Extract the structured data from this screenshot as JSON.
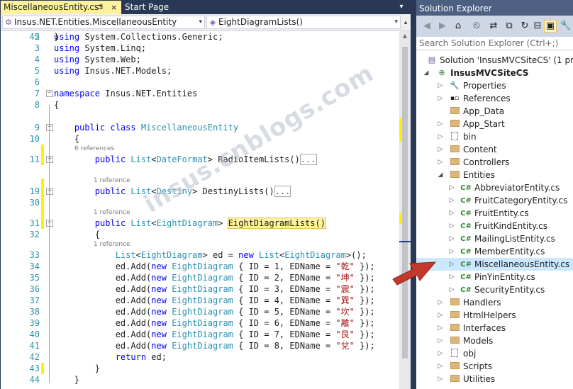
{
  "tabs": {
    "active": {
      "label": "MiscellaneousEntity.cs*",
      "pin": "⊐",
      "close": "×"
    },
    "start_page": {
      "label": "Start Page"
    },
    "dropdown": "▾"
  },
  "navigation": {
    "class_box": "Insus.NET.Entities.MiscellaneousEntity",
    "member_box": "EightDiagramLists()",
    "dropdown_glyph": "▾",
    "split_glyph": "▴"
  },
  "editor": {
    "watermark": "insus.cnblogs.com",
    "lines": [
      {
        "n": "2",
        "code": [
          {
            "c": "k",
            "t": "using"
          },
          {
            "t": " System.Collections.Generic;"
          }
        ]
      },
      {
        "n": "3",
        "code": [
          {
            "c": "k",
            "t": "using"
          },
          {
            "t": " System.Linq;"
          }
        ]
      },
      {
        "n": "4",
        "code": [
          {
            "c": "k",
            "t": "using"
          },
          {
            "t": " System.Web;"
          }
        ]
      },
      {
        "n": "5",
        "code": [
          {
            "c": "k",
            "t": "using"
          },
          {
            "t": " Insus.NET.Models;"
          }
        ]
      },
      {
        "n": "6",
        "code": []
      },
      {
        "n": "7",
        "code": [
          {
            "c": "k",
            "t": "namespace"
          },
          {
            "t": " Insus.NET.Entities"
          }
        ]
      },
      {
        "n": "8",
        "code": [
          {
            "t": "{"
          }
        ]
      },
      {
        "n": "9",
        "code": [
          {
            "t": "    "
          },
          {
            "c": "k",
            "t": "public"
          },
          {
            "t": " "
          },
          {
            "c": "k",
            "t": "class"
          },
          {
            "t": " "
          },
          {
            "c": "t",
            "t": "MiscellaneousEntity"
          }
        ]
      },
      {
        "n": "10",
        "code": [
          {
            "t": "    {"
          }
        ]
      },
      {
        "n": "11",
        "code": [
          {
            "t": "        "
          },
          {
            "c": "k",
            "t": "public"
          },
          {
            "t": " "
          },
          {
            "c": "t",
            "t": "List"
          },
          {
            "t": "<"
          },
          {
            "c": "t",
            "t": "DateFormat"
          },
          {
            "t": "> RadioItemLists()"
          },
          {
            "c": "collapsed",
            "t": "..."
          }
        ]
      },
      {
        "n": "19",
        "code": [
          {
            "t": "        "
          },
          {
            "c": "k",
            "t": "public"
          },
          {
            "t": " "
          },
          {
            "c": "t",
            "t": "List"
          },
          {
            "t": "<"
          },
          {
            "c": "t",
            "t": "Destiny"
          },
          {
            "t": "> DestinyLists()"
          },
          {
            "c": "collapsed",
            "t": "..."
          }
        ]
      },
      {
        "n": "30",
        "code": []
      },
      {
        "n": "31",
        "code": [
          {
            "t": "        "
          },
          {
            "c": "k",
            "t": "public"
          },
          {
            "t": " "
          },
          {
            "c": "t",
            "t": "List"
          },
          {
            "t": "<"
          },
          {
            "c": "t",
            "t": "EightDiagram"
          },
          {
            "t": "> "
          },
          {
            "c": "hl",
            "t": "EightDiagramLists()"
          }
        ]
      },
      {
        "n": "32",
        "code": [
          {
            "t": "        {"
          }
        ]
      },
      {
        "n": "33",
        "code": [
          {
            "t": "            "
          },
          {
            "c": "t",
            "t": "List"
          },
          {
            "t": "<"
          },
          {
            "c": "t",
            "t": "EightDiagram"
          },
          {
            "t": "> ed = "
          },
          {
            "c": "k",
            "t": "new"
          },
          {
            "t": " "
          },
          {
            "c": "t",
            "t": "List"
          },
          {
            "t": "<"
          },
          {
            "c": "t",
            "t": "EightDiagram"
          },
          {
            "t": ">();"
          }
        ]
      },
      {
        "n": "34",
        "code": [
          {
            "t": "            ed.Add("
          },
          {
            "c": "k",
            "t": "new"
          },
          {
            "t": " "
          },
          {
            "c": "t",
            "t": "EightDiagram"
          },
          {
            "t": " { ID = 1, EDName = "
          },
          {
            "c": "s",
            "t": "\"乾\""
          },
          {
            "t": " });"
          }
        ]
      },
      {
        "n": "35",
        "code": [
          {
            "t": "            ed.Add("
          },
          {
            "c": "k",
            "t": "new"
          },
          {
            "t": " "
          },
          {
            "c": "t",
            "t": "EightDiagram"
          },
          {
            "t": " { ID = 2, EDName = "
          },
          {
            "c": "s",
            "t": "\"坤\""
          },
          {
            "t": " });"
          }
        ]
      },
      {
        "n": "36",
        "code": [
          {
            "t": "            ed.Add("
          },
          {
            "c": "k",
            "t": "new"
          },
          {
            "t": " "
          },
          {
            "c": "t",
            "t": "EightDiagram"
          },
          {
            "t": " { ID = 3, EDName = "
          },
          {
            "c": "s",
            "t": "\"震\""
          },
          {
            "t": " });"
          }
        ]
      },
      {
        "n": "37",
        "code": [
          {
            "t": "            ed.Add("
          },
          {
            "c": "k",
            "t": "new"
          },
          {
            "t": " "
          },
          {
            "c": "t",
            "t": "EightDiagram"
          },
          {
            "t": " { ID = 4, EDName = "
          },
          {
            "c": "s",
            "t": "\"巽\""
          },
          {
            "t": " });"
          }
        ]
      },
      {
        "n": "38",
        "code": [
          {
            "t": "            ed.Add("
          },
          {
            "c": "k",
            "t": "new"
          },
          {
            "t": " "
          },
          {
            "c": "t",
            "t": "EightDiagram"
          },
          {
            "t": " { ID = 5, EDName = "
          },
          {
            "c": "s",
            "t": "\"坎\""
          },
          {
            "t": " });"
          }
        ]
      },
      {
        "n": "39",
        "code": [
          {
            "t": "            ed.Add("
          },
          {
            "c": "k",
            "t": "new"
          },
          {
            "t": " "
          },
          {
            "c": "t",
            "t": "EightDiagram"
          },
          {
            "t": " { ID = 6, EDName = "
          },
          {
            "c": "s",
            "t": "\"離\""
          },
          {
            "t": " });"
          }
        ]
      },
      {
        "n": "40",
        "code": [
          {
            "t": "            ed.Add("
          },
          {
            "c": "k",
            "t": "new"
          },
          {
            "t": " "
          },
          {
            "c": "t",
            "t": "EightDiagram"
          },
          {
            "t": " { ID = 7, EDName = "
          },
          {
            "c": "s",
            "t": "\"艮\""
          },
          {
            "t": " });"
          }
        ]
      },
      {
        "n": "41",
        "code": [
          {
            "t": "            ed.Add("
          },
          {
            "c": "k",
            "t": "new"
          },
          {
            "t": " "
          },
          {
            "c": "t",
            "t": "EightDiagram"
          },
          {
            "t": " { ID = 8, EDName = "
          },
          {
            "c": "s",
            "t": "\"兌\""
          },
          {
            "t": " });"
          }
        ]
      },
      {
        "n": "42",
        "code": [
          {
            "t": "            "
          },
          {
            "c": "k",
            "t": "return"
          },
          {
            "t": " ed;"
          }
        ]
      },
      {
        "n": "43",
        "code": [
          {
            "t": "        }"
          }
        ]
      },
      {
        "n": "44",
        "code": [
          {
            "t": "    }"
          }
        ]
      },
      {
        "n": "45",
        "code": [
          {
            "t": "}"
          }
        ]
      }
    ],
    "hints": {
      "class_refs": "6 references",
      "radio_refs": "1 reference",
      "destiny_refs": "1 reference",
      "eight_refs": "1 reference"
    }
  },
  "solution_explorer": {
    "title": "Solution Explorer",
    "search_placeholder": "Search Solution Explorer (Ctrl+;)",
    "toolbar_icons": [
      "back-icon",
      "forward-icon",
      "home-icon",
      "history-icon",
      "sync-icon",
      "pending-changes-icon",
      "refresh-icon",
      "collapse-all-icon",
      "show-all-files-icon",
      "properties-icon"
    ],
    "toolbar_glyphs": [
      "◀",
      "▶",
      "⌂",
      "⏲",
      "⇄",
      "⧉",
      "↻",
      "⊟",
      "▣",
      "🔧"
    ],
    "solution": "Solution 'InsusMVCSiteCS' (1 project)",
    "project": "InsusMVCSiteCS",
    "items": [
      {
        "label": "Properties",
        "type": "wrench",
        "arrow": "▷",
        "depth": 2
      },
      {
        "label": "References",
        "type": "refs",
        "arrow": "▷",
        "depth": 2
      },
      {
        "label": "App_Data",
        "type": "folder",
        "arrow": "",
        "depth": 2
      },
      {
        "label": "App_Start",
        "type": "folder",
        "arrow": "▷",
        "depth": 2
      },
      {
        "label": "bin",
        "type": "file",
        "arrow": "▷",
        "depth": 2
      },
      {
        "label": "Content",
        "type": "folder",
        "arrow": "▷",
        "depth": 2
      },
      {
        "label": "Controllers",
        "type": "folder",
        "arrow": "▷",
        "depth": 2
      },
      {
        "label": "Entities",
        "type": "folder",
        "arrow": "◢",
        "depth": 2
      },
      {
        "label": "AbbreviatorEntity.cs",
        "type": "cs",
        "arrow": "▷",
        "depth": 3
      },
      {
        "label": "FruitCategoryEntity.cs",
        "type": "cs",
        "arrow": "▷",
        "depth": 3
      },
      {
        "label": "FruitEntity.cs",
        "type": "cs",
        "arrow": "▷",
        "depth": 3
      },
      {
        "label": "FruitKindEntity.cs",
        "type": "cs",
        "arrow": "▷",
        "depth": 3
      },
      {
        "label": "MailingListEntity.cs",
        "type": "cs",
        "arrow": "▷",
        "depth": 3
      },
      {
        "label": "MemberEntity.cs",
        "type": "cs",
        "arrow": "▷",
        "depth": 3
      },
      {
        "label": "MiscellaneousEntity.cs",
        "type": "cs",
        "arrow": "▷",
        "depth": 3,
        "selected": true
      },
      {
        "label": "PinYinEntity.cs",
        "type": "cs",
        "arrow": "▷",
        "depth": 3
      },
      {
        "label": "SecurityEntity.cs",
        "type": "cs",
        "arrow": "▷",
        "depth": 3
      },
      {
        "label": "Handlers",
        "type": "folder",
        "arrow": "▷",
        "depth": 2
      },
      {
        "label": "HtmlHelpers",
        "type": "folder",
        "arrow": "▷",
        "depth": 2
      },
      {
        "label": "Interfaces",
        "type": "folder",
        "arrow": "▷",
        "depth": 2
      },
      {
        "label": "Models",
        "type": "folder",
        "arrow": "▷",
        "depth": 2
      },
      {
        "label": "obj",
        "type": "file",
        "arrow": "▷",
        "depth": 2
      },
      {
        "label": "Scripts",
        "type": "folder",
        "arrow": "▷",
        "depth": 2
      },
      {
        "label": "Utilities",
        "type": "folder",
        "arrow": "▷",
        "depth": 2
      }
    ]
  },
  "colors": {
    "accent": "#293955",
    "highlight": "#fff29d",
    "change_bar": "#fff200",
    "arrow": "#c0392b"
  }
}
